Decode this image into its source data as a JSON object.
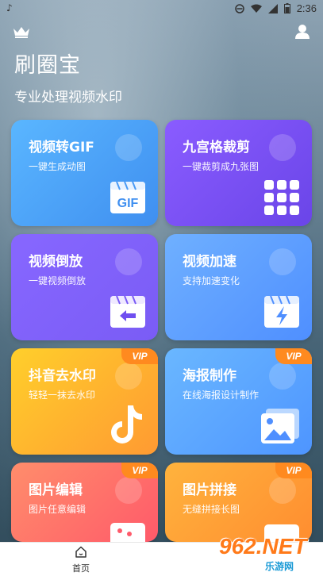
{
  "status": {
    "time": "2:36"
  },
  "header": {
    "title": "刷圈宝",
    "subtitle": "专业处理视频水印"
  },
  "cards": [
    {
      "title": "视频转GIF",
      "desc": "一键生成动图",
      "icon": "gif-icon",
      "vip": false
    },
    {
      "title": "九宫格裁剪",
      "desc": "一键裁剪成九张图",
      "icon": "grid-icon",
      "vip": false
    },
    {
      "title": "视频倒放",
      "desc": "一键视频倒放",
      "icon": "reverse-video-icon",
      "vip": false
    },
    {
      "title": "视频加速",
      "desc": "支持加速变化",
      "icon": "speed-video-icon",
      "vip": false
    },
    {
      "title": "抖音去水印",
      "desc": "轻轻一抹去水印",
      "icon": "tiktok-icon",
      "vip": true
    },
    {
      "title": "海报制作",
      "desc": "在线海报设计制作",
      "icon": "poster-icon",
      "vip": true
    },
    {
      "title": "图片编辑",
      "desc": "图片任意编辑",
      "icon": "image-edit-icon",
      "vip": true
    },
    {
      "title": "图片拼接",
      "desc": "无缝拼接长图",
      "icon": "image-stitch-icon",
      "vip": true
    }
  ],
  "vip_label": "VIP",
  "tabbar": {
    "home_label": "首页"
  },
  "watermark": {
    "main": "962.NET",
    "sub": "乐游网"
  },
  "colors": {
    "vip_badge": "#ff8a1f",
    "gif_card": "#4aa3f8",
    "grid_card": "#7b50f4",
    "tiktok_card": "#ffb52d"
  }
}
